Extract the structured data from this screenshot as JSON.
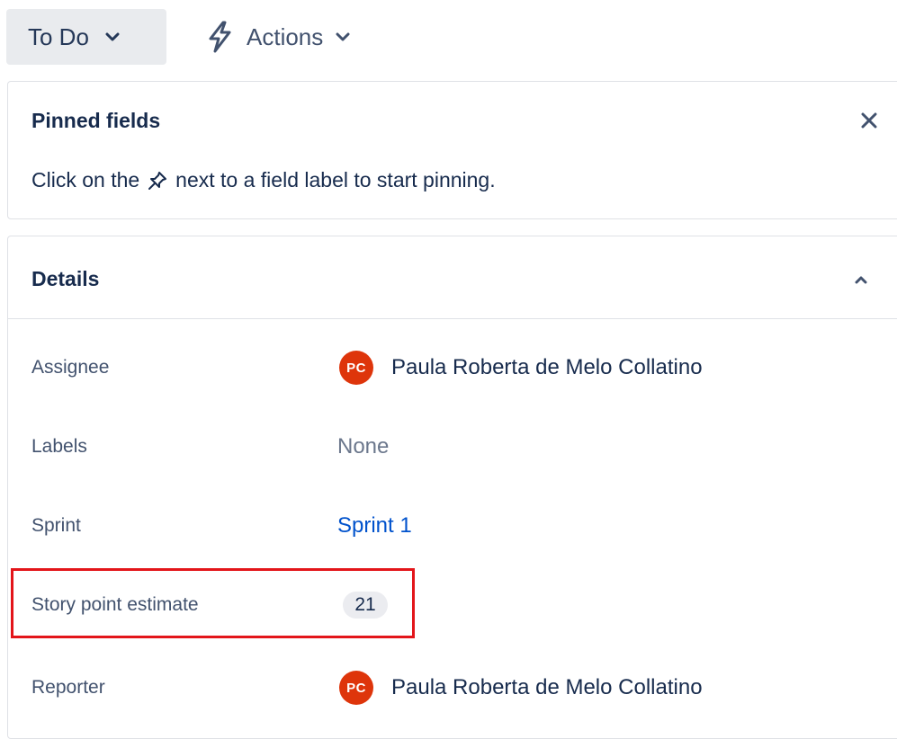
{
  "toolbar": {
    "status_label": "To Do",
    "actions_label": "Actions"
  },
  "pinned_fields": {
    "title": "Pinned fields",
    "hint_before": "Click on the",
    "hint_after": "next to a field label to start pinning."
  },
  "details": {
    "title": "Details",
    "fields": [
      {
        "label": "Assignee",
        "value": "Paula Roberta de Melo Collatino",
        "avatar_initials": "PC"
      },
      {
        "label": "Labels",
        "value": "None"
      },
      {
        "label": "Sprint",
        "value": "Sprint 1"
      },
      {
        "label": "Story point estimate",
        "value": "21"
      },
      {
        "label": "Reporter",
        "value": "Paula Roberta de Melo Collatino",
        "avatar_initials": "PC"
      }
    ]
  },
  "colors": {
    "avatar_bg": "#de350b",
    "link": "#0052cc",
    "highlight_border": "#e3151a"
  },
  "icons": {
    "status_chevron": "chevron-down-icon",
    "actions_bolt": "lightning-icon",
    "actions_chevron": "chevron-down-icon",
    "pinned_close": "close-icon",
    "pin": "pin-icon",
    "details_collapse": "chevron-up-icon"
  }
}
